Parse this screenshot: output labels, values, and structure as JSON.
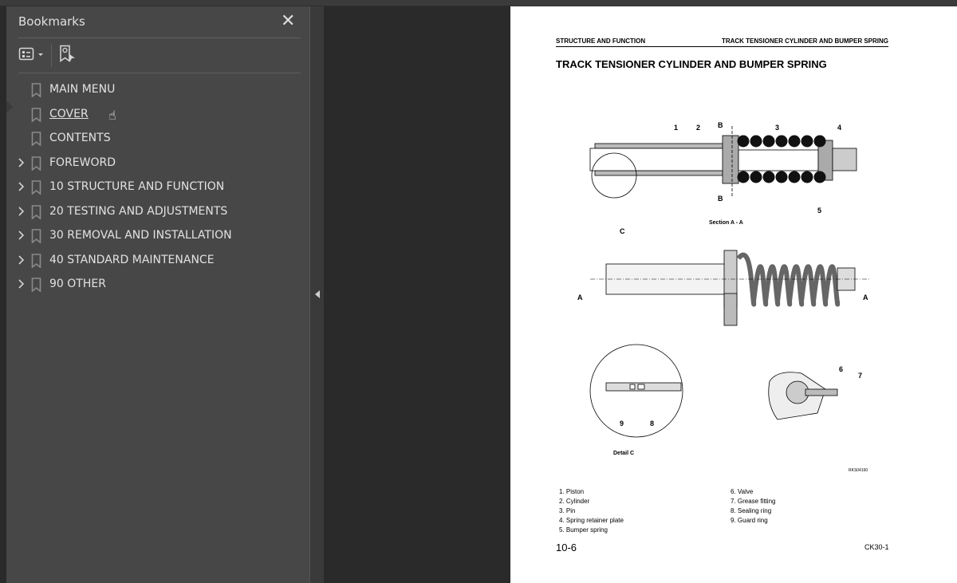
{
  "bookmarks_panel": {
    "title": "Bookmarks",
    "close_icon": "close-icon",
    "options_icon": "list-options-icon",
    "find_bookmark_icon": "find-current-bookmark-icon",
    "items": [
      {
        "label": "MAIN MENU",
        "expandable": false
      },
      {
        "label": "COVER",
        "expandable": false,
        "hovered": true
      },
      {
        "label": "CONTENTS",
        "expandable": false
      },
      {
        "label": "FOREWORD",
        "expandable": true
      },
      {
        "label": "10 STRUCTURE AND FUNCTION",
        "expandable": true
      },
      {
        "label": "20 TESTING AND ADJUSTMENTS",
        "expandable": true
      },
      {
        "label": "30 REMOVAL AND INSTALLATION",
        "expandable": true
      },
      {
        "label": "40 STANDARD MAINTENANCE",
        "expandable": true
      },
      {
        "label": "90 OTHER",
        "expandable": true
      }
    ]
  },
  "document": {
    "header_left": "STRUCTURE AND FUNCTION",
    "header_right": "TRACK TENSIONER CYLINDER AND BUMPER SPRING",
    "title": "TRACK TENSIONER CYLINDER AND BUMPER SPRING",
    "figure": {
      "callouts": [
        "1",
        "2",
        "3",
        "4",
        "5",
        "6",
        "7",
        "8",
        "9",
        "C"
      ],
      "section_marks": [
        "B",
        "B",
        "A",
        "A"
      ],
      "section_caption": "Section A - A",
      "detail_caption": "Detail C",
      "figure_code": "RKS04160"
    },
    "legend_left": [
      "1.  Piston",
      "2.  Cylinder",
      "3.  Pin",
      "4.  Spring retainer plate",
      "5.  Bumper spring"
    ],
    "legend_right": [
      "6.  Valve",
      "7.  Grease fitting",
      "8.  Sealing ring",
      "9.  Guard ring"
    ],
    "page_number": "10-6",
    "model_code": "CK30-1"
  },
  "colors": {
    "panel_bg": "#474747",
    "viewer_bg": "#2a2a2a",
    "page_bg": "#ffffff"
  }
}
